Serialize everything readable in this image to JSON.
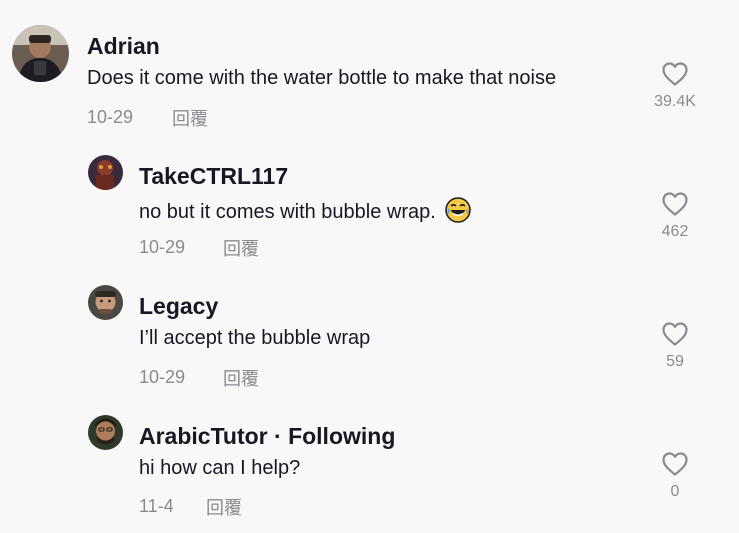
{
  "comments": [
    {
      "username": "Adrian",
      "text": "Does it come with the water bottle to make that noise",
      "date": "10-29",
      "reply_label": "回覆",
      "likes": "39.4K",
      "avatar_icon": "user-avatar-photo"
    },
    {
      "username": "TakeCTRL117",
      "text": "no but it comes with bubble wrap.",
      "emoji": "tears-of-joy-emoji",
      "date": "10-29",
      "reply_label": "回覆",
      "likes": "462",
      "avatar_icon": "user-avatar-photo"
    },
    {
      "username": "Legacy",
      "text": "I’ll accept the bubble wrap",
      "date": "10-29",
      "reply_label": "回覆",
      "likes": "59",
      "avatar_icon": "user-avatar-photo"
    },
    {
      "username": "ArabicTutor · Following",
      "text": "hi how can I help?",
      "date": "11-4",
      "reply_label": "回覆",
      "likes": "0",
      "avatar_icon": "user-avatar-photo"
    }
  ],
  "colors": {
    "background": "#f8f8f8",
    "primary_text": "#161823",
    "secondary_text": "#8a8b91"
  }
}
